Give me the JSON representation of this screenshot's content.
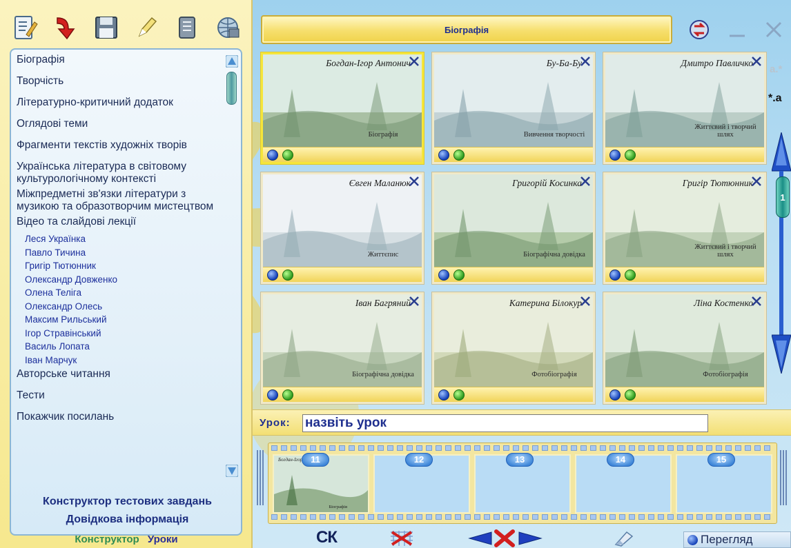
{
  "left_panel": {
    "toolbar": [
      {
        "icon": "checklist-pencil-icon"
      },
      {
        "icon": "red-arrow-icon"
      },
      {
        "icon": "floppy-save-icon"
      },
      {
        "icon": "pen-edit-icon"
      },
      {
        "icon": "notebook-icon"
      },
      {
        "icon": "globe-network-icon"
      }
    ],
    "menu": [
      {
        "label": "Біографія"
      },
      {
        "label": "Творчість"
      },
      {
        "label": "Літературно-критичний додаток"
      },
      {
        "label": "Оглядові теми"
      },
      {
        "label": "Фрагменти текстів художніх творів"
      },
      {
        "label": "Українська література в світовому культурологічному контексті"
      },
      {
        "label": "Міжпредметні зв'язки літератури з музикою та образотворчим мистецтвом"
      },
      {
        "label": "Відео та слайдові лекції"
      }
    ],
    "submenu": [
      "Леся Українка",
      "Павло Тичина",
      "Григір Тютюнник",
      "Олександр Довженко",
      "Олена Теліга",
      "Олександр Олесь",
      "Максим Рильський",
      "Ігор Стравінський",
      "Василь Лопата",
      "Іван Марчук"
    ],
    "menu_after": [
      {
        "label": "Авторське читання"
      },
      {
        "label": "Тести"
      },
      {
        "label": "Покажчик посилань"
      }
    ],
    "links": {
      "constructor_tests": "Конструктор тестових завдань",
      "help": "Довідкова інформація"
    },
    "tabs": {
      "constructor": "Конструктор",
      "lessons": "Уроки"
    }
  },
  "header": {
    "title": "Біографія"
  },
  "side": {
    "font_up": "a.*",
    "font_down": "*.a",
    "page": "1"
  },
  "cards": [
    {
      "name": "Богдан-Ігор Антонич",
      "caption": "Біографія",
      "selected": true
    },
    {
      "name": "Бу-Ба-Бу",
      "caption": "Вивчення творчості",
      "selected": false
    },
    {
      "name": "Дмитро Павличко",
      "caption": "Життєвий і творчий шлях",
      "selected": false
    },
    {
      "name": "Євген Маланюк",
      "caption": "Життєпис",
      "selected": false
    },
    {
      "name": "Григорій Косинка",
      "caption": "Біографічна довідка",
      "selected": false
    },
    {
      "name": "Григір Тютюнник",
      "caption": "Життєвий і творчий шлях",
      "selected": false
    },
    {
      "name": "Іван Багряний",
      "caption": "Біографічна довідка",
      "selected": false
    },
    {
      "name": "Катерина Білокур",
      "caption": "Фотобіографія",
      "selected": false
    },
    {
      "name": "Ліна Костенко",
      "caption": "Фотобіографія",
      "selected": false
    }
  ],
  "lesson": {
    "label": "Урок:",
    "value": "назвіть урок"
  },
  "film": {
    "frames": [
      "11",
      "12",
      "13",
      "14",
      "15"
    ],
    "first_frame_name": "Богдан-Ігор Антонич",
    "first_frame_caption": "Біографія"
  },
  "bottom": {
    "sk": "СК",
    "view": "Перегляд"
  }
}
